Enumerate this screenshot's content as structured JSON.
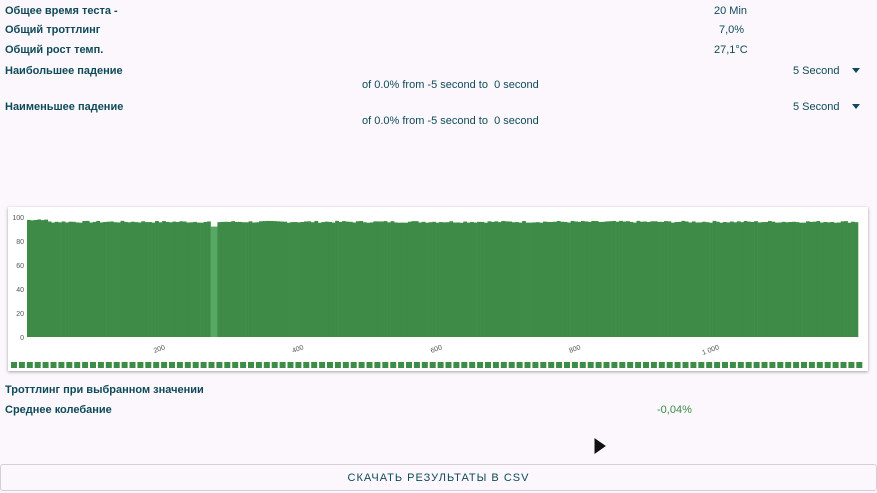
{
  "stats": {
    "total_time_label": "Общее время теста -",
    "total_time_value": "20 Min",
    "throttling_label": "Общий троттлинг",
    "throttling_value": "7,0%",
    "temp_rise_label": "Общий рост темп.",
    "temp_rise_value": "27,1°C"
  },
  "max_drop": {
    "label": "Наибольшее падение",
    "interval": "5 Second",
    "detail": "of 0.0% from -5 second to  0 second"
  },
  "min_drop": {
    "label": "Наименьшее падение",
    "interval": "5 Second",
    "detail": "of 0.0% from -5 second to  0 second"
  },
  "chart_data": {
    "type": "bar",
    "ylim": [
      0,
      100
    ],
    "yticks": [
      "0",
      "20",
      "40",
      "60",
      "80",
      "100"
    ],
    "xlim": [
      0,
      1200
    ],
    "xticks": [
      {
        "value": 200,
        "label": "200"
      },
      {
        "value": 400,
        "label": "400"
      },
      {
        "value": 600,
        "label": "600"
      },
      {
        "value": 800,
        "label": "800"
      },
      {
        "value": 1000,
        "label": "1 000"
      }
    ],
    "bar_color": "#3d8b47",
    "highlight_color": "#56a862",
    "baseline": 96,
    "dip": {
      "start": 267,
      "end": 277,
      "value": 92
    },
    "grid": false
  },
  "selected": {
    "label": "Троттлинг при выбранном значении",
    "avg_label": "Среднее колебание",
    "avg_value": "-0,04%",
    "avg_color": "#3d8b47"
  },
  "download": {
    "label": "СКАЧАТЬ РЕЗУЛЬТАТЫ В CSV"
  }
}
